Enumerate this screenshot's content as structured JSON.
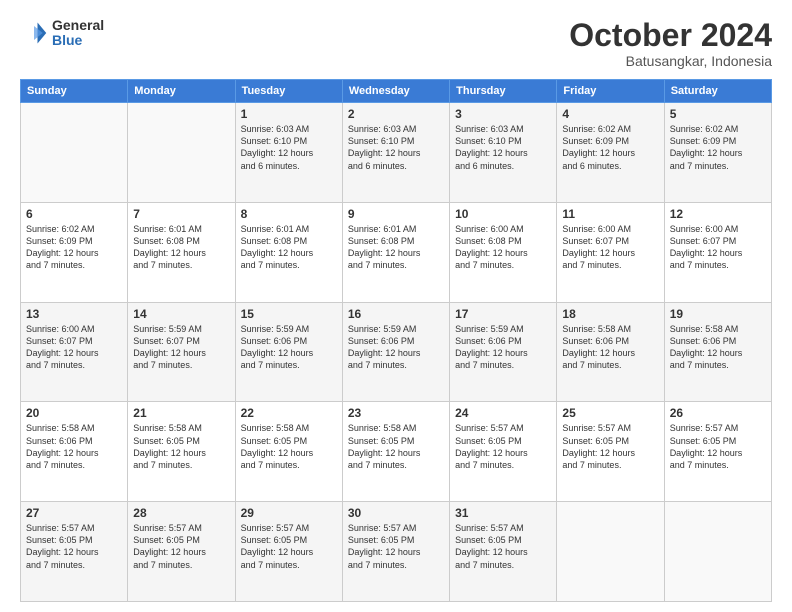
{
  "header": {
    "logo": {
      "line1": "General",
      "line2": "Blue"
    },
    "title": "October 2024",
    "subtitle": "Batusangkar, Indonesia"
  },
  "days_of_week": [
    "Sunday",
    "Monday",
    "Tuesday",
    "Wednesday",
    "Thursday",
    "Friday",
    "Saturday"
  ],
  "weeks": [
    [
      {
        "day": "",
        "info": ""
      },
      {
        "day": "",
        "info": ""
      },
      {
        "day": "1",
        "info": "Sunrise: 6:03 AM\nSunset: 6:10 PM\nDaylight: 12 hours\nand 6 minutes."
      },
      {
        "day": "2",
        "info": "Sunrise: 6:03 AM\nSunset: 6:10 PM\nDaylight: 12 hours\nand 6 minutes."
      },
      {
        "day": "3",
        "info": "Sunrise: 6:03 AM\nSunset: 6:10 PM\nDaylight: 12 hours\nand 6 minutes."
      },
      {
        "day": "4",
        "info": "Sunrise: 6:02 AM\nSunset: 6:09 PM\nDaylight: 12 hours\nand 6 minutes."
      },
      {
        "day": "5",
        "info": "Sunrise: 6:02 AM\nSunset: 6:09 PM\nDaylight: 12 hours\nand 7 minutes."
      }
    ],
    [
      {
        "day": "6",
        "info": "Sunrise: 6:02 AM\nSunset: 6:09 PM\nDaylight: 12 hours\nand 7 minutes."
      },
      {
        "day": "7",
        "info": "Sunrise: 6:01 AM\nSunset: 6:08 PM\nDaylight: 12 hours\nand 7 minutes."
      },
      {
        "day": "8",
        "info": "Sunrise: 6:01 AM\nSunset: 6:08 PM\nDaylight: 12 hours\nand 7 minutes."
      },
      {
        "day": "9",
        "info": "Sunrise: 6:01 AM\nSunset: 6:08 PM\nDaylight: 12 hours\nand 7 minutes."
      },
      {
        "day": "10",
        "info": "Sunrise: 6:00 AM\nSunset: 6:08 PM\nDaylight: 12 hours\nand 7 minutes."
      },
      {
        "day": "11",
        "info": "Sunrise: 6:00 AM\nSunset: 6:07 PM\nDaylight: 12 hours\nand 7 minutes."
      },
      {
        "day": "12",
        "info": "Sunrise: 6:00 AM\nSunset: 6:07 PM\nDaylight: 12 hours\nand 7 minutes."
      }
    ],
    [
      {
        "day": "13",
        "info": "Sunrise: 6:00 AM\nSunset: 6:07 PM\nDaylight: 12 hours\nand 7 minutes."
      },
      {
        "day": "14",
        "info": "Sunrise: 5:59 AM\nSunset: 6:07 PM\nDaylight: 12 hours\nand 7 minutes."
      },
      {
        "day": "15",
        "info": "Sunrise: 5:59 AM\nSunset: 6:06 PM\nDaylight: 12 hours\nand 7 minutes."
      },
      {
        "day": "16",
        "info": "Sunrise: 5:59 AM\nSunset: 6:06 PM\nDaylight: 12 hours\nand 7 minutes."
      },
      {
        "day": "17",
        "info": "Sunrise: 5:59 AM\nSunset: 6:06 PM\nDaylight: 12 hours\nand 7 minutes."
      },
      {
        "day": "18",
        "info": "Sunrise: 5:58 AM\nSunset: 6:06 PM\nDaylight: 12 hours\nand 7 minutes."
      },
      {
        "day": "19",
        "info": "Sunrise: 5:58 AM\nSunset: 6:06 PM\nDaylight: 12 hours\nand 7 minutes."
      }
    ],
    [
      {
        "day": "20",
        "info": "Sunrise: 5:58 AM\nSunset: 6:06 PM\nDaylight: 12 hours\nand 7 minutes."
      },
      {
        "day": "21",
        "info": "Sunrise: 5:58 AM\nSunset: 6:05 PM\nDaylight: 12 hours\nand 7 minutes."
      },
      {
        "day": "22",
        "info": "Sunrise: 5:58 AM\nSunset: 6:05 PM\nDaylight: 12 hours\nand 7 minutes."
      },
      {
        "day": "23",
        "info": "Sunrise: 5:58 AM\nSunset: 6:05 PM\nDaylight: 12 hours\nand 7 minutes."
      },
      {
        "day": "24",
        "info": "Sunrise: 5:57 AM\nSunset: 6:05 PM\nDaylight: 12 hours\nand 7 minutes."
      },
      {
        "day": "25",
        "info": "Sunrise: 5:57 AM\nSunset: 6:05 PM\nDaylight: 12 hours\nand 7 minutes."
      },
      {
        "day": "26",
        "info": "Sunrise: 5:57 AM\nSunset: 6:05 PM\nDaylight: 12 hours\nand 7 minutes."
      }
    ],
    [
      {
        "day": "27",
        "info": "Sunrise: 5:57 AM\nSunset: 6:05 PM\nDaylight: 12 hours\nand 7 minutes."
      },
      {
        "day": "28",
        "info": "Sunrise: 5:57 AM\nSunset: 6:05 PM\nDaylight: 12 hours\nand 7 minutes."
      },
      {
        "day": "29",
        "info": "Sunrise: 5:57 AM\nSunset: 6:05 PM\nDaylight: 12 hours\nand 7 minutes."
      },
      {
        "day": "30",
        "info": "Sunrise: 5:57 AM\nSunset: 6:05 PM\nDaylight: 12 hours\nand 7 minutes."
      },
      {
        "day": "31",
        "info": "Sunrise: 5:57 AM\nSunset: 6:05 PM\nDaylight: 12 hours\nand 7 minutes."
      },
      {
        "day": "",
        "info": ""
      },
      {
        "day": "",
        "info": ""
      }
    ]
  ]
}
